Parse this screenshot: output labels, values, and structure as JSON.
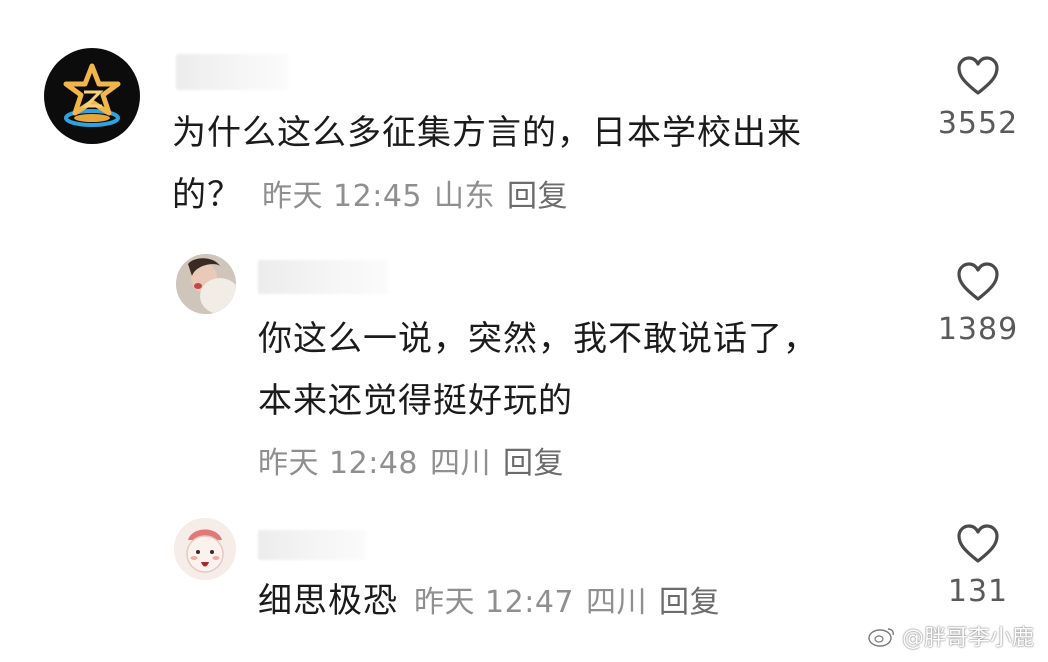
{
  "comments": [
    {
      "text_lines": [
        "为什么这么多征集方言的，日本学校出来",
        "的？"
      ],
      "time": "昨天 12:45",
      "location": "山东",
      "reply": "回复",
      "likes": "3552",
      "like_icon": "heart-outline-icon"
    },
    {
      "text_lines": [
        "你这么一说，突然，我不敢说话了，",
        "本来还觉得挺好玩的"
      ],
      "time": "昨天 12:48",
      "location": "四川",
      "reply": "回复",
      "likes": "1389",
      "like_icon": "heart-outline-icon"
    },
    {
      "text_lines": [
        "细思极恐"
      ],
      "time": "昨天 12:47",
      "location": "四川",
      "reply": "回复",
      "likes": "131",
      "like_icon": "heart-outline-icon"
    }
  ],
  "watermark": "@胖哥李小鹿"
}
